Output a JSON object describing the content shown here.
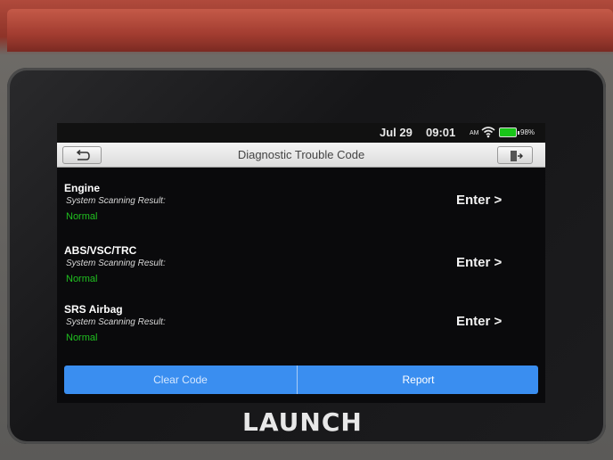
{
  "status_bar": {
    "date": "Jul 29",
    "time": "09:01",
    "ampm": "AM",
    "battery_percent": "98%",
    "icons": [
      "wifi-icon",
      "battery-icon"
    ]
  },
  "header": {
    "title": "Diagnostic Trouble Code",
    "back_icon": "back-arrow-icon",
    "exit_icon": "exit-icon"
  },
  "systems": [
    {
      "name": "Engine",
      "scan_label": "System Scanning Result:",
      "status": "Normal",
      "action": "Enter >"
    },
    {
      "name": "ABS/VSC/TRC",
      "scan_label": "System Scanning Result:",
      "status": "Normal",
      "action": "Enter >"
    },
    {
      "name": "SRS Airbag",
      "scan_label": "System Scanning Result:",
      "status": "Normal",
      "action": "Enter >"
    }
  ],
  "footer": {
    "clear_code_label": "Clear Code",
    "report_label": "Report"
  },
  "device": {
    "brand": "LAUNCH"
  },
  "colors": {
    "status_normal": "#20c020",
    "button_bar": "#3a8ef0",
    "case_red": "#a23c30"
  }
}
